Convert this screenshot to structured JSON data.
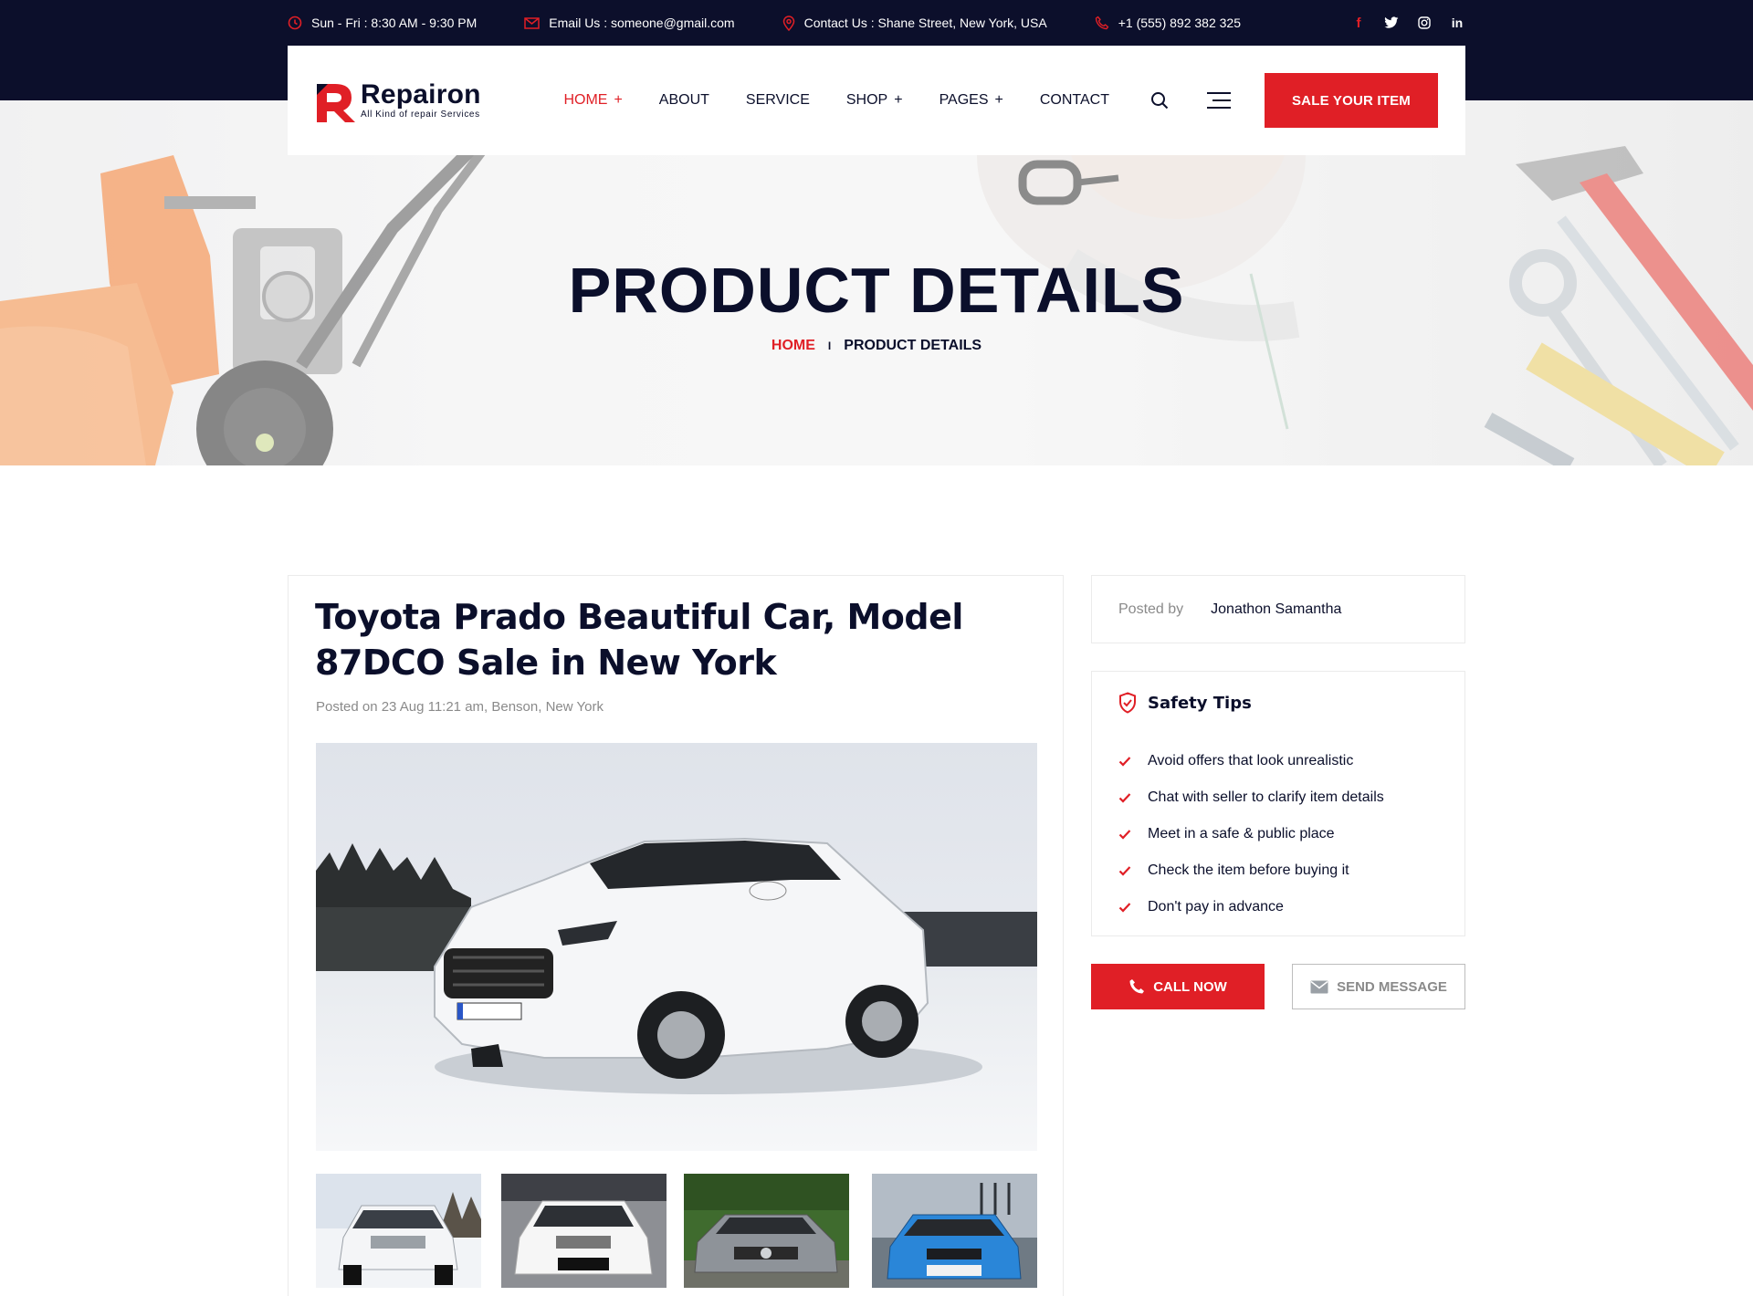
{
  "colors": {
    "accent": "#e01f26",
    "dark": "#0c0f2b",
    "muted": "#8a8a8a"
  },
  "topbar": {
    "hours": "Sun - Fri : 8:30 AM - 9:30 PM",
    "email": "Email Us : someone@gmail.com",
    "address": "Contact Us : Shane Street, New York, USA",
    "phone": "+1 (555) 892 382 325",
    "social": [
      "facebook-icon",
      "twitter-icon",
      "instagram-icon",
      "linkedin-icon"
    ]
  },
  "logo": {
    "name": "Repairon",
    "tagline": "All Kind of repair Services"
  },
  "nav": {
    "items": [
      {
        "label": "HOME",
        "has_sub": true,
        "active": true
      },
      {
        "label": "ABOUT",
        "has_sub": false
      },
      {
        "label": "SERVICE",
        "has_sub": false
      },
      {
        "label": "SHOP",
        "has_sub": true
      },
      {
        "label": "PAGES",
        "has_sub": true
      },
      {
        "label": "CONTACT",
        "has_sub": false
      }
    ],
    "plus": "+",
    "cta": "SALE YOUR ITEM"
  },
  "hero": {
    "title": "PRODUCT DETAILS",
    "breadcrumb": {
      "home": "HOME",
      "separator": "I",
      "current": "PRODUCT DETAILS"
    }
  },
  "product": {
    "title": "Toyota Prado Beautiful Car, Model 87DCO Sale in New York",
    "meta": "Posted on 23 Aug 11:21 am, Benson, New York"
  },
  "seller": {
    "label": "Posted by",
    "name": "Jonathon Samantha"
  },
  "safety": {
    "title": "Safety Tips",
    "tips": [
      "Avoid offers that look unrealistic",
      "Chat with seller to clarify item details",
      "Meet in a safe & public place",
      "Check the item before buying it",
      "Don't pay in advance"
    ]
  },
  "actions": {
    "call": "CALL NOW",
    "message": "SEND MESSAGE"
  }
}
